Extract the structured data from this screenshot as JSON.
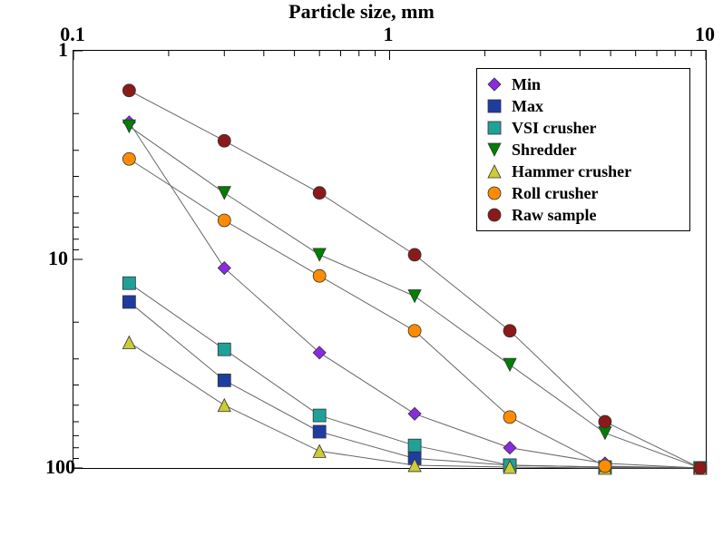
{
  "chart_data": {
    "type": "line",
    "title": "Particle size, mm",
    "xscale": "log",
    "yscale": "log_rev",
    "xlim": [
      0.1,
      10
    ],
    "ylim_display_top": 1,
    "ylim_display_bottom": 100,
    "x_ticks": [
      0.1,
      1,
      10
    ],
    "y_ticks": [
      1,
      10,
      100
    ],
    "series": [
      {
        "name": "Min",
        "marker": "diamond",
        "color": "#8a2be2",
        "x": [
          0.15,
          0.3,
          0.6,
          1.2,
          2.4,
          4.8,
          9.6
        ],
        "y": [
          2.2,
          11,
          28,
          55,
          80,
          95,
          100
        ]
      },
      {
        "name": "Max",
        "marker": "square",
        "color": "#1f3da1",
        "x": [
          0.15,
          0.3,
          0.6,
          1.2,
          2.4,
          4.8,
          9.6
        ],
        "y": [
          16,
          38,
          67,
          90,
          97,
          99,
          100
        ]
      },
      {
        "name": "VSI crusher",
        "marker": "square",
        "color": "#1fa198",
        "x": [
          0.15,
          0.3,
          0.6,
          1.2,
          2.4,
          4.8,
          9.6
        ],
        "y": [
          13,
          27,
          56,
          78,
          97,
          99,
          100
        ]
      },
      {
        "name": "Shredder",
        "marker": "tri-down",
        "color": "#008000",
        "x": [
          0.15,
          0.3,
          0.6,
          1.2,
          2.4,
          4.8,
          9.6
        ],
        "y": [
          2.3,
          4.8,
          9.5,
          15,
          32,
          68,
          100
        ]
      },
      {
        "name": "Hammer crusher",
        "marker": "tri-up",
        "color": "#cccc33",
        "x": [
          0.15,
          0.3,
          0.6,
          1.2,
          2.4,
          4.8,
          9.6
        ],
        "y": [
          25,
          50,
          83,
          97,
          99,
          100,
          100
        ]
      },
      {
        "name": "Roll crusher",
        "marker": "circle",
        "color": "#ff8c00",
        "x": [
          0.15,
          0.3,
          0.6,
          1.2,
          2.4,
          4.8,
          9.6
        ],
        "y": [
          3.3,
          6.5,
          12,
          22,
          57,
          98,
          100
        ]
      },
      {
        "name": "Raw sample",
        "marker": "circle",
        "color": "#8b1a1a",
        "x": [
          0.15,
          0.3,
          0.6,
          1.2,
          2.4,
          4.8,
          9.6
        ],
        "y": [
          1.55,
          2.7,
          4.8,
          9.5,
          22,
          60,
          100
        ]
      }
    ],
    "legend_position": "upper-right"
  },
  "axis": {
    "x_title": "Particle size, mm",
    "x_tick_labels": [
      "0.1",
      "1",
      "10"
    ],
    "y_tick_labels": [
      "1",
      "10",
      "100"
    ]
  }
}
